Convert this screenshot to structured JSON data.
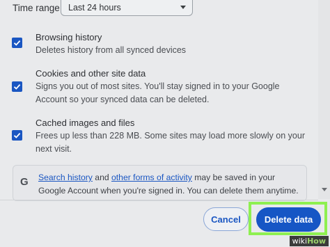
{
  "time_range": {
    "label": "Time range",
    "value": "Last 24 hours"
  },
  "items": [
    {
      "title": "Browsing history",
      "description": "Deletes history from all synced devices",
      "checked": true
    },
    {
      "title": "Cookies and other site data",
      "description": "Signs you out of most sites. You'll stay signed in to your Google Account so your synced data can be deleted.",
      "checked": true
    },
    {
      "title": "Cached images and files",
      "description": "Frees up less than 228 MB. Some sites may load more slowly on your next visit.",
      "checked": true
    }
  ],
  "info": {
    "icon": "google-g-icon",
    "link1": "Search history",
    "and": " and ",
    "link2": "other forms of activity",
    "rest": " may be saved in your Google Account when you're signed in. You can delete them anytime."
  },
  "buttons": {
    "cancel": "Cancel",
    "delete": "Delete data"
  },
  "watermark": {
    "prefix": "wiki",
    "suffix": "How"
  },
  "colors": {
    "accent": "#1656c5",
    "highlight": "#8ef051"
  }
}
